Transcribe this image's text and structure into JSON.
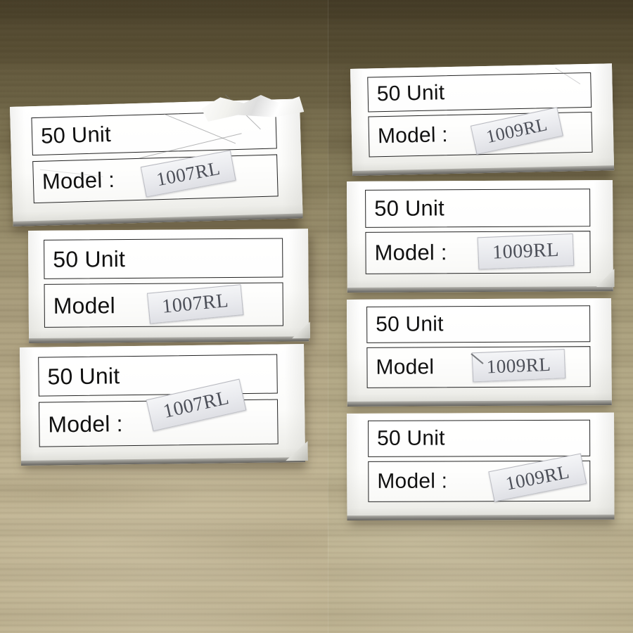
{
  "scene": {
    "title": "Product boxes on wood surface",
    "layout": "two-photo composite, left pane and right pane",
    "surface": "wood grain table",
    "colors": {
      "wood_top": "#5d5338",
      "wood_bottom": "#c2b695",
      "box_white": "#fdfdfb",
      "label_border": "#222222",
      "label_text": "#111111",
      "sticker_bg": "#e9eaee",
      "sticker_text": "#4c4f58"
    }
  },
  "panes": [
    {
      "id": "left-pane",
      "name": "left-photo",
      "model_group": "1007RL",
      "box_count": 3
    },
    {
      "id": "right-pane",
      "name": "right-photo",
      "model_group": "1009RL",
      "box_count": 4
    }
  ],
  "boxes": [
    {
      "id": "L1",
      "pane": "left",
      "quantity_label": "50 Unit",
      "model_label": "Model :",
      "model_value": "1007RL",
      "condition": "crumpled torn top-right corner",
      "sticker_rotation": "-9deg"
    },
    {
      "id": "L2",
      "pane": "left",
      "quantity_label": "50 Unit",
      "model_label": "Model",
      "model_value": "1007RL",
      "condition": "intact",
      "sticker_rotation": "-5deg"
    },
    {
      "id": "L3",
      "pane": "left",
      "quantity_label": "50 Unit",
      "model_label": "Model :",
      "model_value": "1007RL",
      "condition": "folded bottom-right corner",
      "sticker_rotation": "-12deg"
    },
    {
      "id": "R1",
      "pane": "right",
      "quantity_label": "50 Unit",
      "model_label": "Model :",
      "model_value": "1009RL",
      "condition": "slightly skewed",
      "sticker_rotation": "-11deg"
    },
    {
      "id": "R2",
      "pane": "right",
      "quantity_label": "50 Unit",
      "model_label": "Model :",
      "model_value": "1009RL",
      "condition": "intact",
      "sticker_rotation": "-2deg"
    },
    {
      "id": "R3",
      "pane": "right",
      "quantity_label": "50 Unit",
      "model_label": "Model",
      "model_value": "1009RL",
      "condition": "small tear mark before model number",
      "sticker_rotation": "-2deg"
    },
    {
      "id": "R4",
      "pane": "right",
      "quantity_label": "50 Unit",
      "model_label": "Model :",
      "model_value": "1009RL",
      "condition": "intact",
      "sticker_rotation": "-11deg"
    }
  ],
  "summary": {
    "total_boxes": "7",
    "units_per_box": "50",
    "models_present": "1007RL, 1009RL"
  }
}
